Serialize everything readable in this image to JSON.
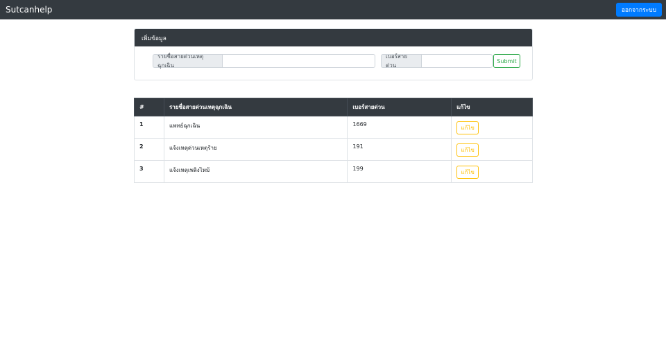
{
  "navbar": {
    "brand": "Sutcanhelp",
    "logout_label": "ออกจากระบบ"
  },
  "form": {
    "header": "เพิ่มข้อมูล",
    "name_label": "รายชื่อสายด่วนเหตุฉุกเฉิน",
    "name_value": "",
    "number_label": "เบอร์สายด่วน",
    "number_value": "",
    "submit_label": "Submit"
  },
  "table": {
    "columns": [
      "#",
      "รายชื่อสายด่วนเหตุฉุกเฉิน",
      "เบอร์สายด่วน",
      "แก้ไข"
    ],
    "rows": [
      {
        "index": "1",
        "name": "แพทย์ฉุกเฉิน",
        "number": "1669",
        "edit_label": "แก้ไข"
      },
      {
        "index": "2",
        "name": "แจ้งเหตุด่วนเหตุร้าย",
        "number": "191",
        "edit_label": "แก้ไข"
      },
      {
        "index": "3",
        "name": "แจ้งเหตุเพลิงไหม้",
        "number": "199",
        "edit_label": "แก้ไข"
      }
    ]
  },
  "colors": {
    "navbar_bg": "#343a40",
    "primary": "#007bff",
    "success": "#28a745",
    "warning": "#ffc107"
  }
}
